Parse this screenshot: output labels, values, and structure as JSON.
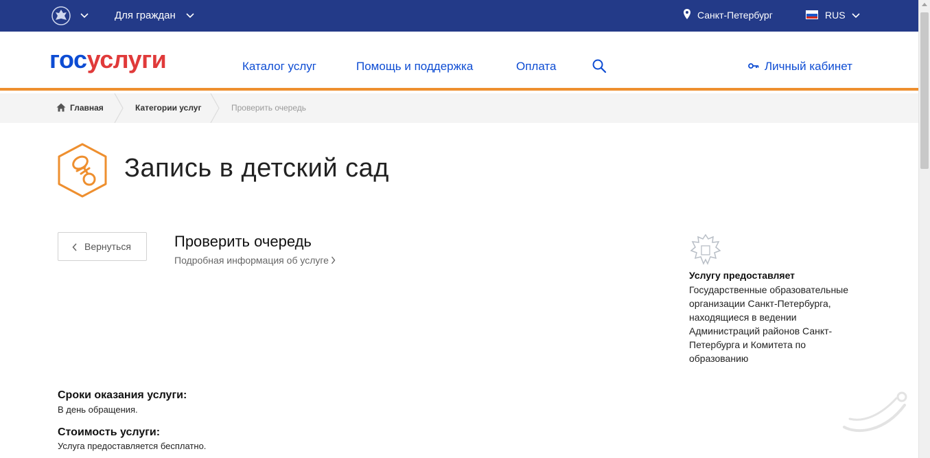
{
  "topbar": {
    "citizens_label": "Для граждан",
    "city": "Санкт-Петербург",
    "language": "RUS"
  },
  "header": {
    "logo_part1": "гос",
    "logo_part2": "услуги",
    "nav": [
      "Каталог услуг",
      "Помощь и поддержка",
      "Оплата"
    ],
    "cabinet_label": "Личный кабинет"
  },
  "breadcrumb": {
    "home": "Главная",
    "categories": "Категории услуг",
    "current": "Проверить очередь"
  },
  "page": {
    "title": "Запись в детский сад",
    "back_label": "Вернуться",
    "service_title": "Проверить очередь",
    "service_more": "Подробная информация об услуге"
  },
  "provider": {
    "heading": "Услугу предоставляет",
    "text": "Государственные образовательные организации Санкт-Петербурга, находящиеся в ведении Администраций районов Санкт-Петербурга и Комитета по образованию"
  },
  "details": {
    "term_heading": "Сроки оказания услуги:",
    "term_value": "В день обращения.",
    "cost_heading": "Стоимость услуги:",
    "cost_value": "Услуга предоставляется бесплатно."
  },
  "colors": {
    "topbar_bg": "#233a88",
    "link_blue": "#0d4cd3",
    "logo_red": "#e03a3a",
    "accent_orange": "#ee8f2f"
  },
  "icons": [
    "emblem-icon",
    "chevron-down-icon",
    "location-pin-icon",
    "flag-icon",
    "search-icon",
    "key-icon",
    "home-icon",
    "pacifier-icon",
    "chevron-left-icon",
    "chevron-right-icon"
  ]
}
